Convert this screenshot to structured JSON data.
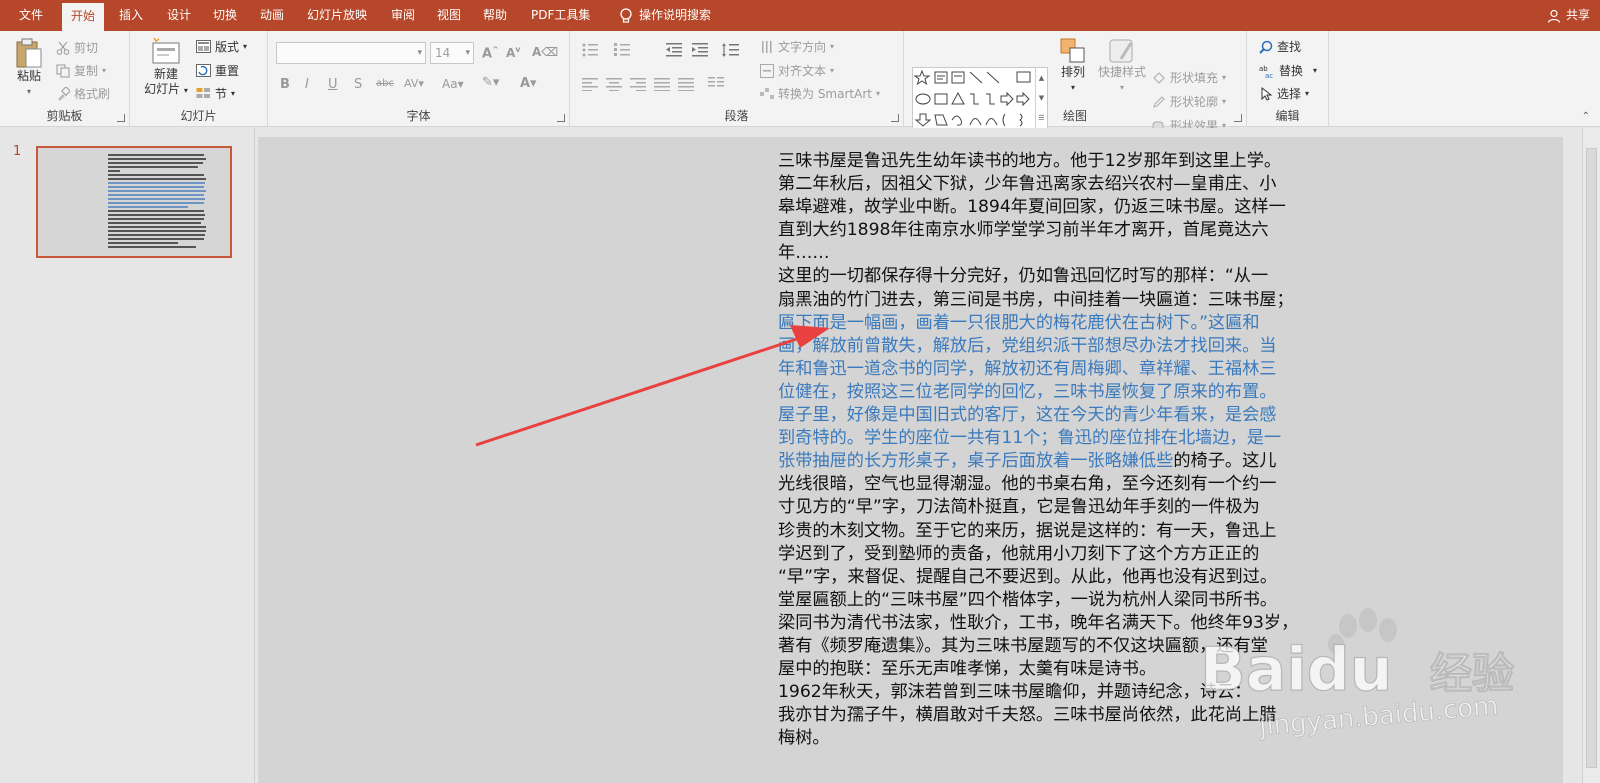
{
  "tabs": [
    "文件",
    "开始",
    "插入",
    "设计",
    "切换",
    "动画",
    "幻灯片放映",
    "审阅",
    "视图",
    "帮助",
    "PDF工具集"
  ],
  "active_tab": "开始",
  "tell_me": "操作说明搜索",
  "share": "共享",
  "clipboard": {
    "paste": "粘贴",
    "cut": "剪切",
    "copy": "复制",
    "format_painter": "格式刷",
    "label": "剪贴板"
  },
  "slides_group": {
    "new_slide_1": "新建",
    "new_slide_2": "幻灯片",
    "layout": "版式",
    "reset": "重置",
    "section": "节",
    "label": "幻灯片"
  },
  "font_group": {
    "font_size": "14",
    "label": "字体"
  },
  "paragraph_group": {
    "text_direction": "文字方向",
    "align_text": "对齐文本",
    "smartart": "转换为 SmartArt",
    "label": "段落"
  },
  "drawing_group": {
    "arrange": "排列",
    "quick_styles": "快捷样式",
    "shape_fill": "形状填充",
    "shape_outline": "形状轮廓",
    "shape_effects": "形状效果",
    "label": "绘图"
  },
  "editing_group": {
    "find": "查找",
    "replace": "替换",
    "select": "选择",
    "label": "编辑"
  },
  "slide_number": "1",
  "slide_text": {
    "line1": "三味书屋是鲁迅先生幼年读书的地方。他于12岁那年到这里上学。",
    "line2": "第二年秋后，因祖父下狱，少年鲁迅离家去绍兴农村—皇甫庄、小",
    "line3": "皋埠避难，故学业中断。1894年夏间回家，仍返三味书屋。这样一",
    "line4": "直到大约1898年往南京水师学堂学习前半年才离开，首尾竟达六",
    "line5": "年……",
    "line6": "这里的一切都保存得十分完好，仍如鲁迅回忆时写的那样：“从一",
    "line7": "扇黑油的竹门进去，第三间是书房，中间挂着一块匾道：三味书屋；",
    "line8": "匾下面是一幅画，画着一只很肥大的梅花鹿伏在古树下。”这匾和",
    "line9": "画，解放前曾散失，解放后，党组织派干部想尽办法才找回来。当",
    "line10": "年和鲁迅一道念书的同学，解放初还有周梅卿、章祥耀、王福林三",
    "line11": "位健在，按照这三位老同学的回忆，三味书屋恢复了原来的布置。",
    "line12": "屋子里，好像是中国旧式的客厅，这在今天的青少年看来，是会感",
    "line13": "到奇特的。学生的座位一共有11个；鲁迅的座位排在北墙边，是一",
    "line14a": "张带抽屉的长方形桌子，桌子后面放着一张略嫌低些",
    "line14b": "的椅子。这儿",
    "line15": "光线很暗，空气也显得潮湿。他的书桌右角，至今还刻有一个约一",
    "line16": "寸见方的“早”字，刀法简朴挺直，它是鲁迅幼年手刻的一件极为",
    "line17": "珍贵的木刻文物。至于它的来历，据说是这样的：有一天，鲁迅上",
    "line18": "学迟到了，受到塾师的责备，他就用小刀刻下了这个方方正正的",
    "line19": "“早”字，来督促、提醒自己不要迟到。从此，他再也没有迟到过。",
    "line20": "堂屋匾额上的“三味书屋”四个楷体字，一说为杭州人梁同书所书。",
    "line21": "梁同书为清代书法家，性耿介，工书，晚年名满天下。他终年93岁，",
    "line22": "著有《频罗庵遗集》。其为三味书屋题写的不仅这块匾额，还有堂",
    "line23": "屋中的抱联：至乐无声唯孝悌，太羹有味是诗书。",
    "line24": "1962年秋天，郭沫若曾到三味书屋瞻仰，并题诗纪念，诗云：",
    "line25": "我亦甘为孺子牛，横眉敢对千夫怒。三味书屋尚依然，此花尚上腊",
    "line26": "梅树。"
  },
  "watermark": {
    "brand": "Baidu",
    "cn": "经验",
    "url": "jingyan.baidu.com"
  },
  "colors": {
    "accent": "#b7472a",
    "highlight_text": "#3a7abd",
    "arrow": "#e8413f"
  }
}
